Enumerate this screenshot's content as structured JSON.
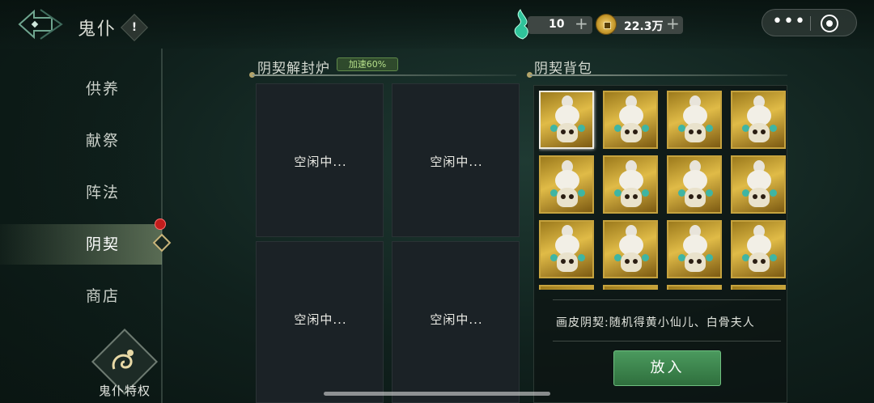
{
  "header": {
    "title": "鬼仆",
    "info_label": "!"
  },
  "currency": {
    "jade": {
      "value": "10",
      "plus": "+"
    },
    "coin": {
      "value": "22.3万",
      "plus": "+"
    }
  },
  "system": {
    "more": "•••"
  },
  "sidebar": {
    "items": [
      {
        "label": "供养"
      },
      {
        "label": "献祭"
      },
      {
        "label": "阵法"
      },
      {
        "label": "阴契"
      },
      {
        "label": "商店"
      }
    ],
    "privilege_label": "鬼仆特权"
  },
  "furnace": {
    "title": "阴契解封炉",
    "speed_badge": "加速60%",
    "slots": [
      {
        "status": "空闲中..."
      },
      {
        "status": "空闲中..."
      },
      {
        "status": "空闲中..."
      },
      {
        "status": "空闲中..."
      }
    ]
  },
  "bag": {
    "title": "阴契背包",
    "item_count_visible": 16,
    "selected_index": 0,
    "description": "画皮阴契:随机得黄小仙儿、白骨夫人",
    "put_button": "放入"
  },
  "colors": {
    "accent_green": "#3f8f52",
    "gold": "#c6a33e",
    "badge_text": "#b6e08a",
    "red_dot": "#c21d1d"
  }
}
